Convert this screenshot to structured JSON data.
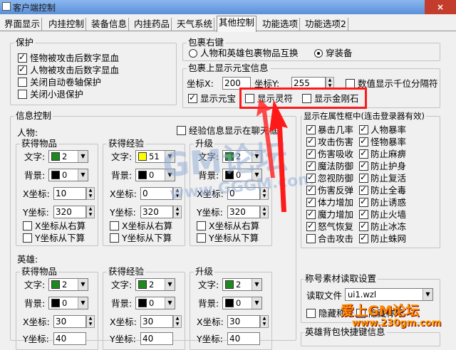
{
  "window": {
    "title": "客户端控制",
    "close": "×"
  },
  "tabs": [
    "界面显示",
    "内挂控制",
    "装备信息",
    "内挂药品",
    "天气系统",
    "其他控制",
    "功能选项",
    "功能选项2"
  ],
  "protect": {
    "legend": "保护",
    "items": [
      {
        "label": "怪物被攻击后数字显血",
        "checked": true
      },
      {
        "label": "人物被攻击后数字显血",
        "checked": true
      },
      {
        "label": "关闭自动卷轴保护",
        "checked": false
      },
      {
        "label": "关闭小退保护",
        "checked": false
      }
    ]
  },
  "bag": {
    "legend": "包裹右键",
    "opt1": "人物和英雄包裹物品互换",
    "opt2": "穿装备"
  },
  "ingot": {
    "legend": "包裹上显示元宝信息",
    "x_label": "坐标X:",
    "x_value": "200",
    "y_label": "坐标Y:",
    "y_value": "255",
    "thousand": "数值显示千位分隔符",
    "show_yuanbao": "显示元宝",
    "show_lingfu": "显示灵符",
    "show_jingangshi": "显示金刚石"
  },
  "info": {
    "legend": "信息控制",
    "person": "人物:",
    "hero": "英雄:",
    "exp_frame": "经验信息显示在聊天框",
    "get_item": "获得物品",
    "get_exp": "获得经验",
    "levelup": "升级",
    "text": "文字:",
    "bg": "背景:",
    "x": "X坐标:",
    "y": "Y坐标:",
    "right": "X坐标从右算",
    "bottom": "Y坐标从下算",
    "p_item": {
      "text": "2",
      "bg": "0",
      "x": "10",
      "y": "320"
    },
    "p_exp": {
      "text": "51",
      "bg": "0",
      "x": "0",
      "y": "320"
    },
    "p_lvl": {
      "text": "2",
      "bg": "0",
      "x": "0",
      "y": "320"
    },
    "h_item": {
      "text": "2",
      "bg": "0",
      "x": "30",
      "y": "40"
    },
    "h_exp": {
      "text": "2",
      "bg": "0",
      "x": "30",
      "y": "40"
    },
    "h_lvl": {
      "text": "2",
      "bg": "0",
      "x": "30",
      "y": "40"
    }
  },
  "attr": {
    "legend": "显示在属性框中(连击登录器有效)",
    "items": [
      [
        "暴击几率",
        "人物暴率"
      ],
      [
        "攻击伤害",
        "怪物暴率"
      ],
      [
        "伤害吸收",
        "防止麻痹"
      ],
      [
        "魔法防御",
        "防止护身"
      ],
      [
        "忽视防御",
        "防止复活"
      ],
      [
        "伤害反弹",
        "防止全毒"
      ],
      [
        "体力增加",
        "防止诱惑"
      ],
      [
        "魔力增加",
        "防止火墙"
      ],
      [
        "怒气恢复",
        "防止冰冻"
      ],
      [
        "合击攻击",
        "防止蛛网"
      ]
    ]
  },
  "title_res": {
    "legend": "称号素材读取设置",
    "read_file": "读取文件",
    "file": "ui1.wzl",
    "hide": "隐藏称号",
    "hide2": "隐藏称号"
  },
  "hero_bag": {
    "legend": "英雄背包快捷键信息"
  },
  "watermark": {
    "big": "GM论坛",
    "url": "www.GGGM.com",
    "brand": "爱上GM论坛",
    "site": "www.230gm.com"
  },
  "colors": {
    "green": "#1d8a1d",
    "yellow": "#ffff00",
    "black": "#000000",
    "red": "#ff1a1a"
  }
}
